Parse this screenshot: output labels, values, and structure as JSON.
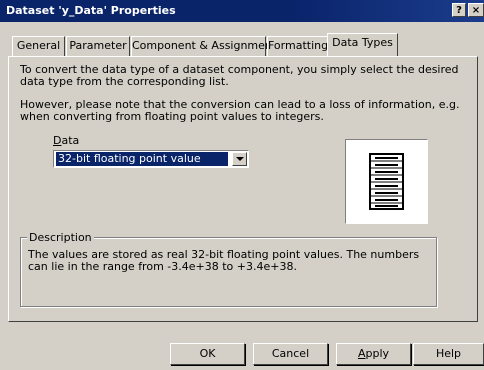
{
  "window": {
    "title": "Dataset 'y_Data' Properties",
    "help_button": "?",
    "close_button": "×"
  },
  "tabs": [
    {
      "label": "General",
      "active": false
    },
    {
      "label": "Parameter",
      "active": false
    },
    {
      "label": "Component & Assignments",
      "active": false
    },
    {
      "label": "Formatting",
      "active": false
    },
    {
      "label": "Data Types",
      "active": true
    }
  ],
  "content": {
    "intro": "To convert the data type of a dataset component, you simply select the desired data type from the corresponding list.",
    "warning": "However, please note that the conversion can lead to a loss of information, e.g. when converting from floating point values to integers.",
    "data_label": "Data",
    "data_label_accel": "D",
    "data_label_rest": "ata",
    "data_type_selected": "32-bit floating point value",
    "icon": "data-table-icon"
  },
  "description": {
    "legend": "Description",
    "text": "The values are stored as real 32-bit floating point values. The numbers can lie in the range from -3.4e+38 to +3.4e+38."
  },
  "buttons": {
    "ok": "OK",
    "cancel": "Cancel",
    "apply_accel": "A",
    "apply_rest": "pply",
    "apply": "Apply",
    "help": "Help"
  },
  "colors": {
    "titlebar": "#0a246a",
    "face": "#d4d0c8",
    "selection": "#0a246a"
  }
}
